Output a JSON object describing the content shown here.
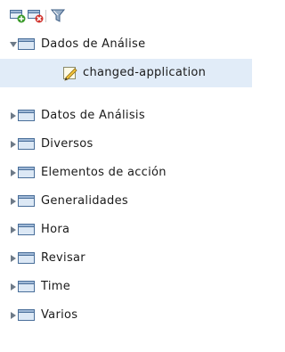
{
  "toolbar": {
    "buttons": [
      {
        "icon": "add-node-icon"
      },
      {
        "icon": "remove-node-icon"
      },
      {
        "icon": "filter-icon"
      }
    ]
  },
  "tree": {
    "rows": [
      {
        "label": "Dados de Análise",
        "expanded": true,
        "level": 0,
        "icon": "folder-icon"
      },
      {
        "label": "changed-application",
        "level": 1,
        "selected": true,
        "icon": "edit-document-icon"
      },
      {
        "label": "Datos de Análisis",
        "expanded": false,
        "level": 0,
        "icon": "folder-icon"
      },
      {
        "label": "Diversos",
        "expanded": false,
        "level": 0,
        "icon": "folder-icon"
      },
      {
        "label": "Elementos de acción",
        "expanded": false,
        "level": 0,
        "icon": "folder-icon"
      },
      {
        "label": "Generalidades",
        "expanded": false,
        "level": 0,
        "icon": "folder-icon"
      },
      {
        "label": "Hora",
        "expanded": false,
        "level": 0,
        "icon": "folder-icon"
      },
      {
        "label": "Revisar",
        "expanded": false,
        "level": 0,
        "icon": "folder-icon"
      },
      {
        "label": "Time",
        "expanded": false,
        "level": 0,
        "icon": "folder-icon"
      },
      {
        "label": "Varios",
        "expanded": false,
        "level": 0,
        "icon": "folder-icon"
      }
    ]
  },
  "colors": {
    "selection": "#e1ecf8",
    "folder_border": "#4a6f9a",
    "folder_fill": "#dce8f5",
    "add_green": "#3a9a2a",
    "remove_red": "#d0302a",
    "toggle": "#6d7a88"
  }
}
